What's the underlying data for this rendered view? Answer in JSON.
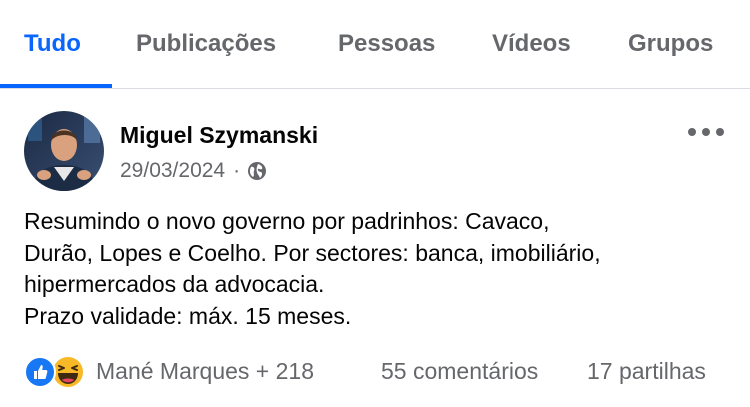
{
  "tabs": [
    {
      "label": "Tudo",
      "active": true
    },
    {
      "label": "Publicações",
      "active": false
    },
    {
      "label": "Pessoas",
      "active": false
    },
    {
      "label": "Vídeos",
      "active": false
    },
    {
      "label": "Grupos",
      "active": false
    }
  ],
  "post": {
    "author": "Miguel Szymanski",
    "date": "29/03/2024",
    "separator": "·",
    "privacy_icon": "globe-icon",
    "menu_icon": "more-options-icon",
    "text_lines": [
      "Resumindo o novo governo por padrinhos: Cavaco,",
      "Durão, Lopes e Coelho. Por sectores: banca, imobiliário,",
      "hipermercados da advocacia.",
      "Prazo validade: máx. 15 meses."
    ],
    "reaction_icons": [
      "like-icon",
      "haha-icon"
    ],
    "reactors": "Mané Marques + 218",
    "comments": "55 comentários",
    "shares": "17 partilhas"
  },
  "colors": {
    "accent": "#0866ff",
    "secondary_text": "#65676b",
    "like_blue": "#1877f2",
    "haha_yellow": "#f7b928"
  }
}
